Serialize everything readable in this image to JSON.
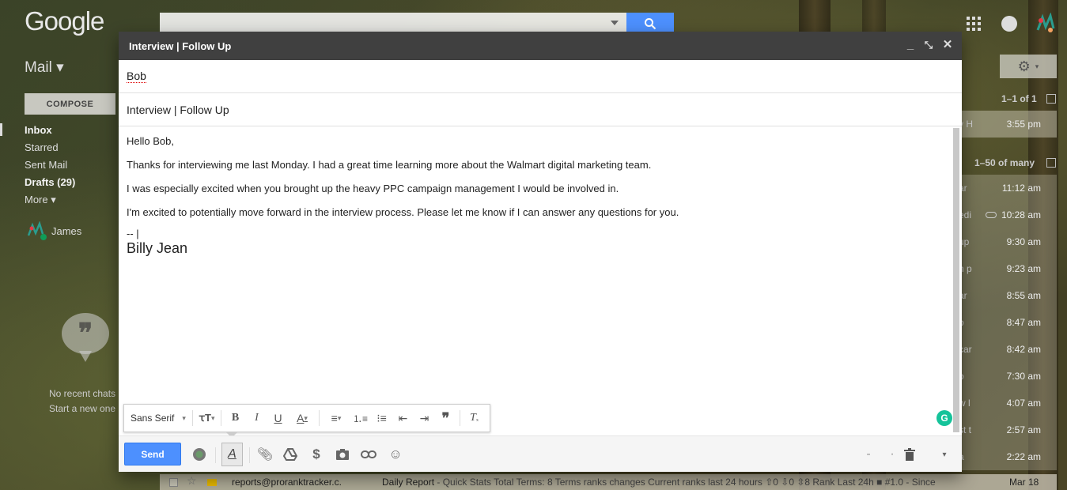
{
  "app": {
    "logo_text": "Google",
    "mail_label": "Mail ▾",
    "compose_label": "COMPOSE"
  },
  "nav": [
    {
      "label": "Inbox",
      "bold": true
    },
    {
      "label": "Starred",
      "bold": false
    },
    {
      "label": "Sent Mail",
      "bold": false
    },
    {
      "label": "Drafts (29)",
      "bold": true
    },
    {
      "label": "More ▾",
      "bold": false
    }
  ],
  "user": {
    "name": "James"
  },
  "chat": {
    "line1": "No recent chats",
    "line2": "Start a new one"
  },
  "list": {
    "count_top": "1–1 of 1",
    "count_main": "1–50 of many",
    "top_row": {
      "snippet": "y H",
      "time": "3:55 pm"
    },
    "rows": [
      {
        "snippet": "ar",
        "time": "11:12 am"
      },
      {
        "snippet": "edi",
        "time": "10:28 am",
        "attachment": true
      },
      {
        "snippet": "up",
        "time": "9:30 am"
      },
      {
        "snippet": "n p",
        "time": "9:23 am"
      },
      {
        "snippet": "ar",
        "time": "8:55 am"
      },
      {
        "snippet": "o",
        "time": "8:47 am"
      },
      {
        "snippet": "car",
        "time": "8:42 am"
      },
      {
        "snippet": "o",
        "time": "7:30 am"
      },
      {
        "snippet": "w l",
        "time": "4:07 am"
      },
      {
        "snippet": "st t",
        "time": "2:57 am"
      },
      {
        "snippet": "a",
        "time": "2:22 am"
      }
    ],
    "bottom_row": {
      "sender": "reports@proranktracker.c.",
      "subject": "Daily Report",
      "snippet": " - Quick Stats Total Terms: 8 Terms ranks changes Current ranks last 24 hours ⇧0 ⇩0 ⇳8 Rank Last 24h ■ #1.0 - Since",
      "date": "Mar 18"
    }
  },
  "compose": {
    "window_title": "Interview | Follow Up",
    "to": "Bob",
    "subject": "Interview | Follow Up",
    "body": [
      "Hello Bob,",
      "Thanks for interviewing me last Monday. I had a great time learning more about the Walmart digital marketing team.",
      "I was especially excited when you brought up the heavy PPC campaign management I would be involved in.",
      "I'm excited to potentially move forward in the interview process. Please let me know if I can answer any questions for you."
    ],
    "signature_dash": "-- |",
    "signature_name": "Billy Jean",
    "font_select": "Sans Serif",
    "send_label": "Send"
  },
  "colors": {
    "send_blue": "#4d90fe",
    "title_bar": "#404040",
    "grammarly": "#15c39a"
  }
}
